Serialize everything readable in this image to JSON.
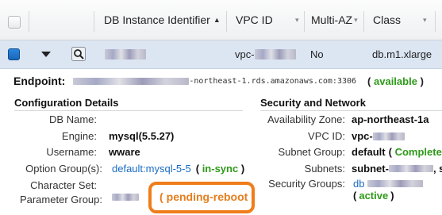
{
  "header": {
    "col_identifier": "DB Instance Identifier",
    "col_vpc": "VPC ID",
    "col_multiaz": "Multi-AZ",
    "col_class": "Class",
    "sort_glyph": "▲",
    "menu_glyph": "▾"
  },
  "row": {
    "vpc_prefix": "vpc-",
    "multi_az": "No",
    "class": "db.m1.xlarge"
  },
  "endpoint": {
    "label": "Endpoint:",
    "host_visible": "-northeast-1.rds.amazonaws.com:3306",
    "status": "available",
    "paren_open": "(",
    "paren_close": ")"
  },
  "config": {
    "title": "Configuration Details",
    "rows": [
      {
        "label": "DB Name:",
        "value": ""
      },
      {
        "label": "Engine:",
        "value": "mysql(5.5.27)"
      },
      {
        "label": "Username:",
        "value": "wware"
      },
      {
        "label": "Option Group(s):",
        "value": "default:mysql-5-5",
        "status": "in-sync"
      },
      {
        "label": "Character Set:",
        "value": ""
      },
      {
        "label": "Parameter Group:",
        "value": "",
        "status": "pending-reboot"
      }
    ]
  },
  "security": {
    "title": "Security and Network",
    "rows": [
      {
        "label": "Availability Zone:",
        "value": "ap-northeast-1a"
      },
      {
        "label": "VPC ID:",
        "value": "vpc-"
      },
      {
        "label": "Subnet Group:",
        "value": "default",
        "status": "Complete"
      },
      {
        "label": "Subnets:",
        "value": "subnet-",
        "trail": ", s"
      },
      {
        "label": "Security Groups:",
        "value": "db",
        "status": "active"
      }
    ]
  },
  "colors": {
    "selected_row": "#dce6f3",
    "status_green": "#2e9a1a",
    "status_orange": "#e67e1c",
    "link_blue": "#1a6bc4",
    "callout_orange": "#ef7d1a"
  }
}
